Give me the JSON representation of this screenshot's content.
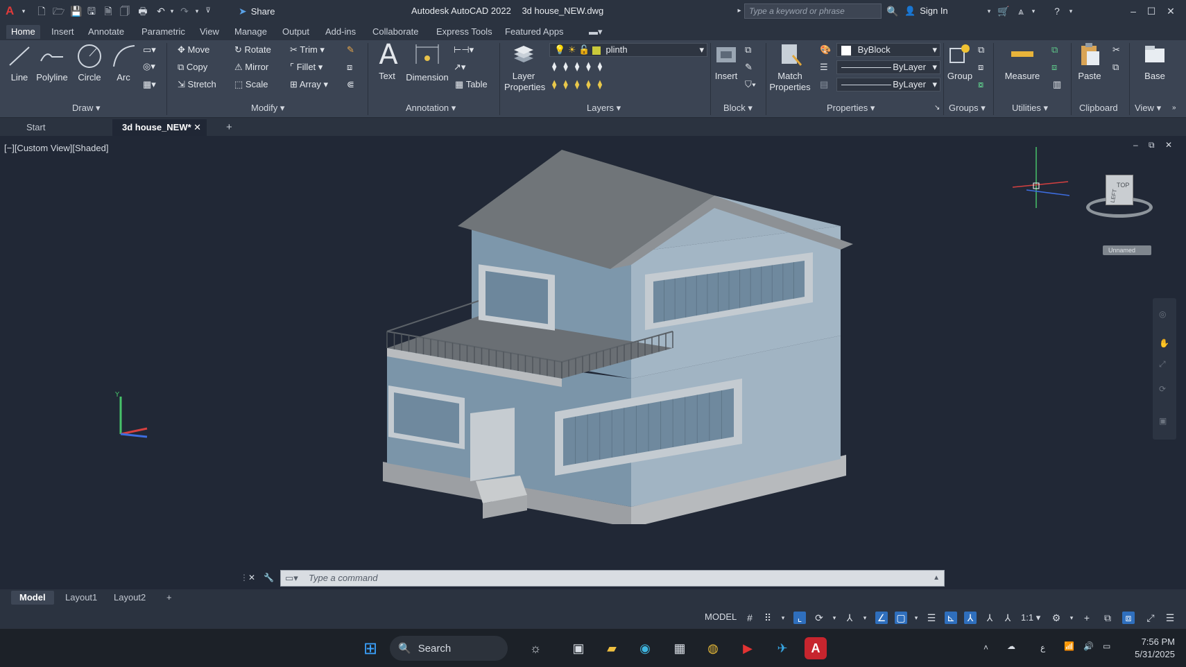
{
  "titlebar": {
    "app_title": "Autodesk AutoCAD 2022",
    "file_title": "3d house_NEW.dwg",
    "share": "Share",
    "search_placeholder": "Type a keyword or phrase",
    "sign_in": "Sign In"
  },
  "menu_tabs": [
    "Home",
    "Insert",
    "Annotate",
    "Parametric",
    "View",
    "Manage",
    "Output",
    "Add-ins",
    "Collaborate",
    "Express Tools",
    "Featured Apps"
  ],
  "ribbon": {
    "draw": {
      "line": "Line",
      "polyline": "Polyline",
      "circle": "Circle",
      "arc": "Arc",
      "panel": "Draw"
    },
    "modify": {
      "move": "Move",
      "rotate": "Rotate",
      "trim": "Trim",
      "copy": "Copy",
      "mirror": "Mirror",
      "fillet": "Fillet",
      "stretch": "Stretch",
      "scale": "Scale",
      "array": "Array",
      "panel": "Modify"
    },
    "annotation": {
      "text": "Text",
      "dimension": "Dimension",
      "table": "Table",
      "panel": "Annotation"
    },
    "layers": {
      "layer_properties": "Layer Properties",
      "current_layer": "plinth",
      "panel": "Layers"
    },
    "block": {
      "insert": "Insert",
      "panel": "Block"
    },
    "properties": {
      "match": "Match Properties",
      "color": "ByBlock",
      "linetype": "ByLayer",
      "lineweight": "ByLayer",
      "panel": "Properties"
    },
    "groups": {
      "group": "Group",
      "panel": "Groups"
    },
    "utilities": {
      "measure": "Measure",
      "panel": "Utilities"
    },
    "clipboard": {
      "paste": "Paste",
      "panel": "Clipboard"
    },
    "view": {
      "base": "Base",
      "panel": "View"
    }
  },
  "file_tabs": {
    "start": "Start",
    "active": "3d house_NEW*"
  },
  "viewport": {
    "label": "[−][Custom View][Shaded]",
    "viewcube_top": "TOP",
    "viewcube_left": "LEFT",
    "named_view": "Unnamed"
  },
  "command": {
    "placeholder": "Type a command"
  },
  "layout_tabs": [
    "Model",
    "Layout1",
    "Layout2"
  ],
  "status": {
    "model": "MODEL",
    "scale": "1:1"
  },
  "taskbar": {
    "search": "Search",
    "time": "7:56 PM",
    "date": "5/31/2025"
  },
  "colors": {
    "accent": "#2f6fbd",
    "house_wall": "#7f99ad",
    "roof": "#6f747a",
    "ribbon": "#3b4453",
    "viewport": "#212836"
  }
}
